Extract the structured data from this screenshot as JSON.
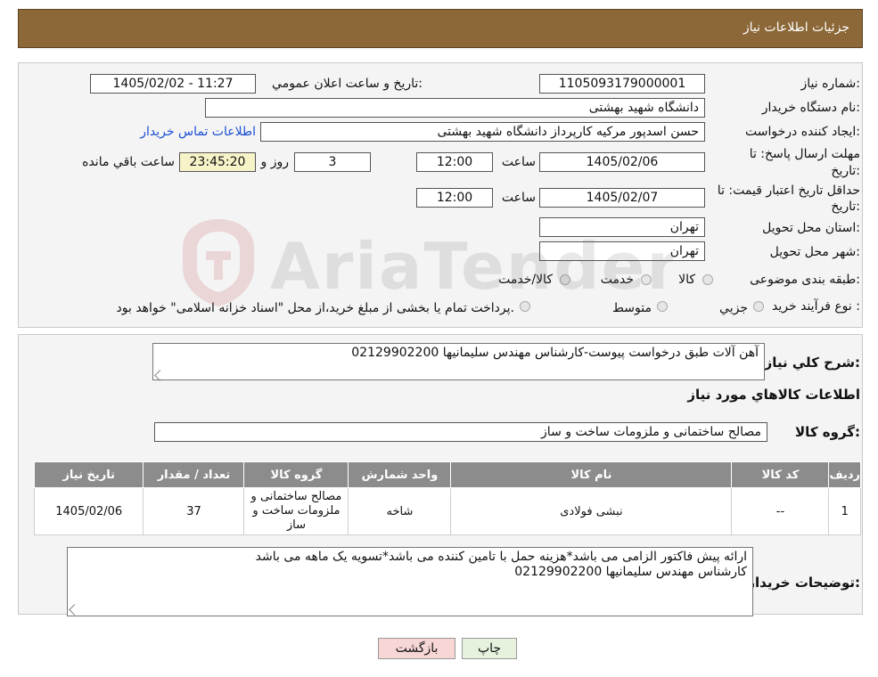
{
  "header": {
    "title": "جزئیات اطلاعات نیاز"
  },
  "form": {
    "need_number_label": "شماره نیاز:",
    "need_number": "1105093179000001",
    "announce_label": "تاریخ و ساعت اعلان عمومي:",
    "announce_value": "1405/02/02 - 11:27",
    "buyer_org_label": "نام دستگاه خریدار:",
    "buyer_org": "دانشگاه شهید بهشتی",
    "creator_label": "ایجاد کننده درخواست:",
    "creator": "حسن اسدپور مرکیه کارپرداز دانشگاه شهید بهشتی",
    "contact_link": "اطلاعات تماس خریدار",
    "deadline_label_1": "مهلت ارسال پاسخ: تا",
    "deadline_label_2": "تاریخ:",
    "deadline_date": "1405/02/06",
    "time_label": "ساعت",
    "deadline_time": "12:00",
    "days_value": "3",
    "days_label": "روز و",
    "remaining_value": "23:45:20",
    "remaining_label": "ساعت باقي مانده",
    "validity_label_1": "حداقل تاریخ اعتبار قیمت: تا",
    "validity_label_2": "تاریخ:",
    "validity_date": "1405/02/07",
    "validity_time": "12:00",
    "province_label": "استان محل تحویل:",
    "province": "تهران",
    "city_label": "شهر محل تحویل:",
    "city": "تهران",
    "category_label": "طبقه بندی موضوعی:",
    "category_options": [
      "کالا",
      "خدمت",
      "کالا/خدمت"
    ],
    "process_label": "نوع فرآیند خرید :",
    "process_options": [
      "جزیي",
      "متوسط"
    ],
    "process_note": "پرداخت تمام یا بخشی از مبلغ خرید،از محل \"اسناد خزانه اسلامی\" خواهد بود."
  },
  "summary": {
    "label": "شرح کلي نياز:",
    "value": "آهن آلات طبق درخواست پیوست-کارشناس مهندس سلیمانیها 02129902200"
  },
  "goods_info_title": "اطلاعات کالاهاي مورد نياز",
  "goods_group": {
    "label": "گروه کالا:",
    "value": "مصالح ساختمانی و ملزومات ساخت و ساز"
  },
  "table": {
    "headers": [
      "رديف",
      "كد كالا",
      "نام كالا",
      "واحد شمارش",
      "گروه كالا",
      "تعداد / مقدار",
      "تاريخ نياز"
    ],
    "rows": [
      {
        "idx": "1",
        "code": "--",
        "name": "نبشی فولادی",
        "unit": "شاخه",
        "group": "مصالح ساختمانی و ملزومات ساخت و ساز",
        "qty": "37",
        "date": "1405/02/06"
      }
    ]
  },
  "buyer_notes": {
    "label": "توضيحات خريدار:",
    "line1": "ارائه پیش فاکتور الزامی می باشد*هزینه حمل با تامین کننده می باشد*تسویه یک ماهه می باشد",
    "line2": "کارشناس مهندس سلیمانیها 02129902200"
  },
  "buttons": {
    "print": "چاپ",
    "back": "بازگشت"
  },
  "watermark": {
    "text": "AriaTender.neT"
  },
  "colors": {
    "header": "#8c6838",
    "table_header": "#8c8c8c",
    "link": "#1a4fd6",
    "remaining_bg": "#f7f3c8",
    "back_btn_bg": "#f7d6d6",
    "print_btn_bg": "#e6f2de"
  }
}
